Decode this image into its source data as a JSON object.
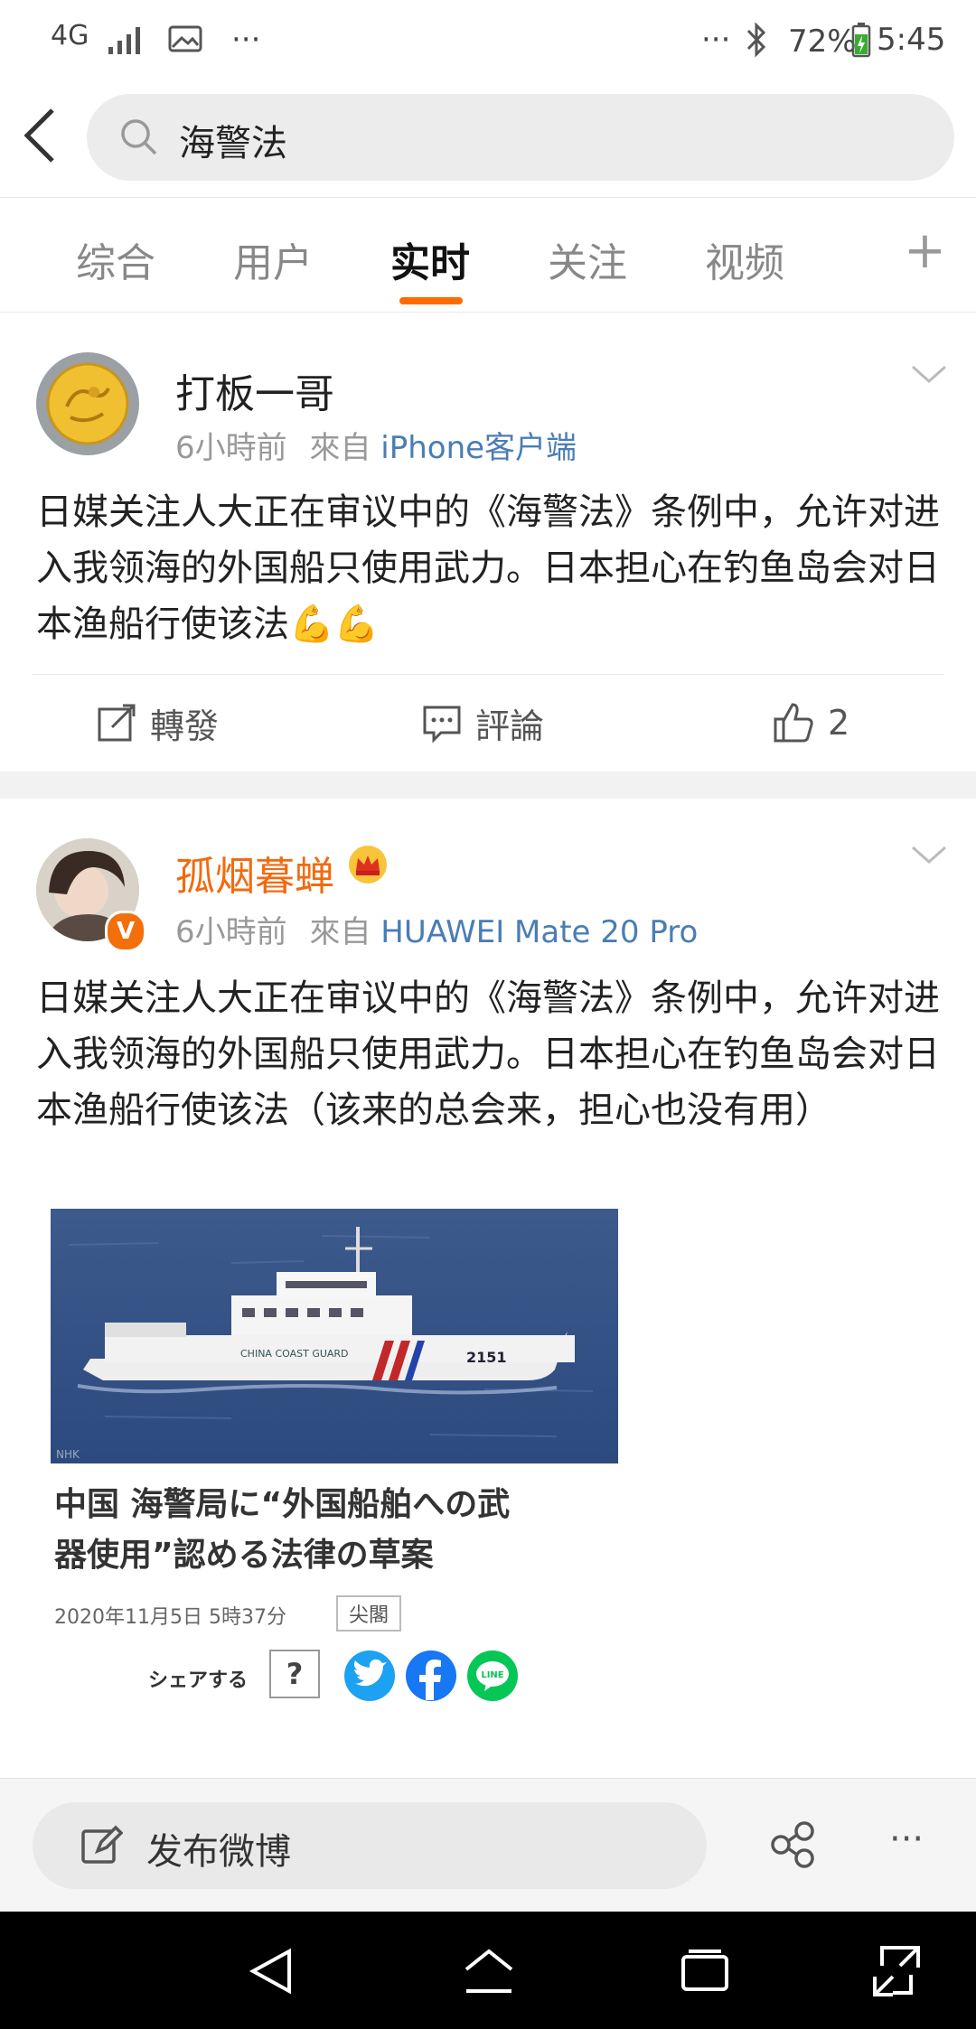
{
  "status_bar": {
    "network": "4G",
    "dots_left": "···",
    "dots_right": "···",
    "battery": "72%",
    "time": "5:45"
  },
  "search": {
    "query": "海警法"
  },
  "tabs": [
    {
      "label": "综合"
    },
    {
      "label": "用户"
    },
    {
      "label": "实时"
    },
    {
      "label": "关注"
    },
    {
      "label": "视频"
    }
  ],
  "tab_add": "+",
  "posts": [
    {
      "user": "打板一哥",
      "time": "6小時前",
      "from_label": "來自",
      "source": "iPhone客户端",
      "text": "日媒关注人大正在审议中的《海警法》条例中，允许对进入我领海的外国船只使用武力。日本担心在钓鱼岛会对日本渔船行使该法",
      "emoji": "💪💪",
      "actions": {
        "repost": "轉發",
        "comment": "評論",
        "like_count": "2"
      }
    },
    {
      "user": "孤烟暮蝉",
      "time": "6小時前",
      "from_label": "來自",
      "source": "HUAWEI Mate 20 Pro",
      "text": "日媒关注人大正在审议中的《海警法》条例中，允许对进入我领海的外国船只使用武力。日本担心在钓鱼岛会对日本渔船行使该法（该来的总会来，担心也没有用）",
      "verified_badge": "V",
      "image": {
        "ship_hull_text": "CHINA COAST GUARD",
        "ship_number": "2151",
        "watermark": "NHK",
        "headline_line1": "中国 海警局に“外国船舶への武",
        "headline_line2": "器使用”認める法律の草案",
        "date": "2020年11月5日 5時37分",
        "tag": "尖閣",
        "share_label": "シェアする",
        "help": "?",
        "line_label": "LINE"
      }
    }
  ],
  "bottom_bar": {
    "compose_label": "发布微博",
    "more": "···"
  },
  "colors": {
    "accent": "#ff6a00",
    "source_link": "#4a7db5",
    "vip_name": "#f26a10"
  }
}
